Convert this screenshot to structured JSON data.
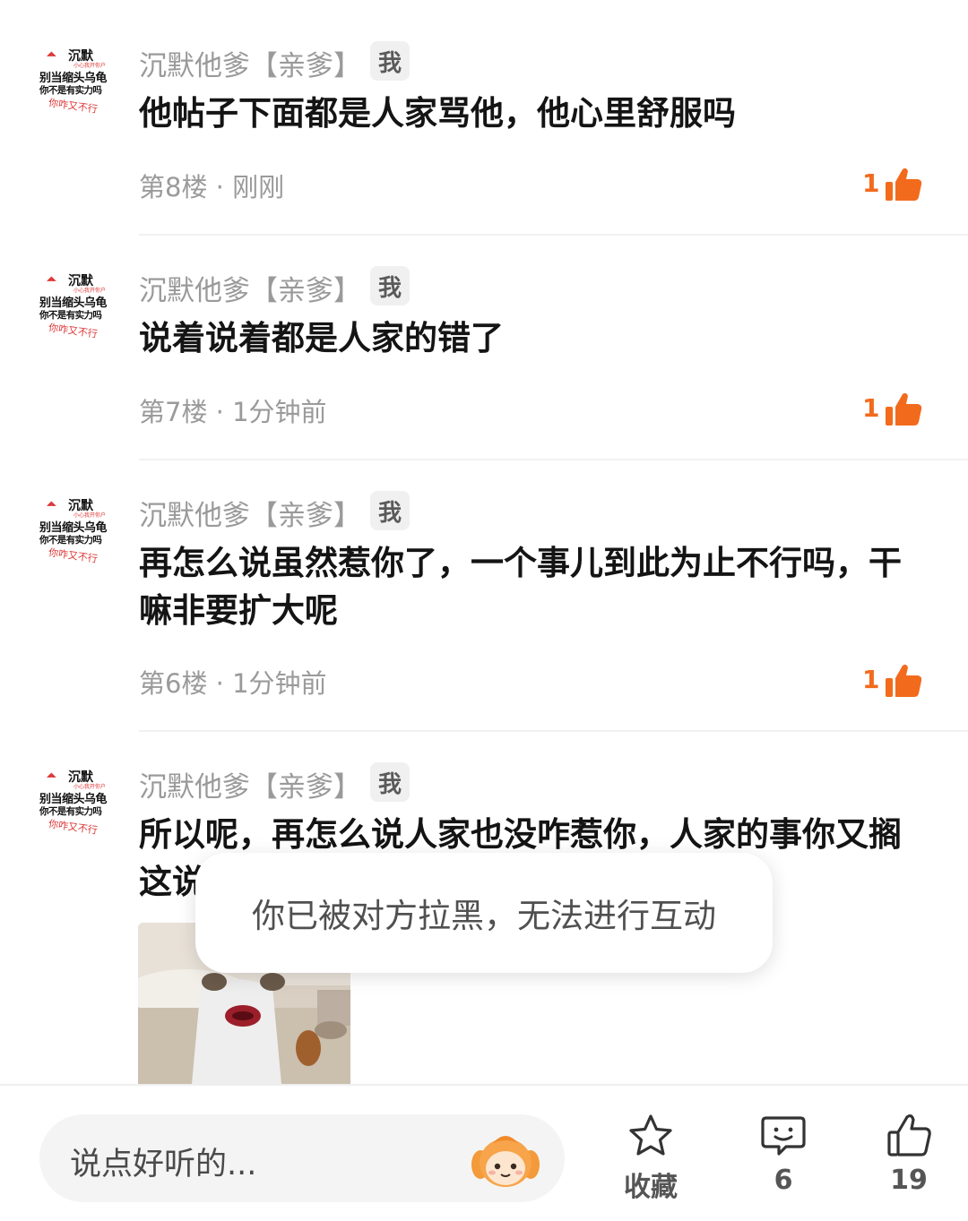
{
  "comments": [
    {
      "avatar": {
        "line1": "沉默",
        "line0": "",
        "line2": "小心我开你户",
        "line3": "别当缩头乌龟",
        "line4": "你不是有实力吗",
        "line5": "你咋又不行"
      },
      "nickname": "沉默他爹【亲爹】",
      "me_badge": "我",
      "text": "他帖子下面都是人家骂他，他心里舒服吗",
      "meta": "第8楼 · 刚刚",
      "likes": "1"
    },
    {
      "avatar": {
        "line1": "沉默",
        "line0": "",
        "line2": "小心我开你户",
        "line3": "别当缩头乌龟",
        "line4": "你不是有实力吗",
        "line5": "你咋又不行"
      },
      "nickname": "沉默他爹【亲爹】",
      "me_badge": "我",
      "text": "说着说着都是人家的错了",
      "meta": "第7楼 · 1分钟前",
      "likes": "1"
    },
    {
      "avatar": {
        "line1": "沉默",
        "line0": "",
        "line2": "小心我开你户",
        "line3": "别当缩头乌龟",
        "line4": "你不是有实力吗",
        "line5": "你咋又不行"
      },
      "nickname": "沉默他爹【亲爹】",
      "me_badge": "我",
      "text": "再怎么说虽然惹你了，一个事儿到此为止不行吗，干嘛非要扩大呢",
      "meta": "第6楼 · 1分钟前",
      "likes": "1"
    },
    {
      "avatar": {
        "line1": "沉默",
        "line0": "",
        "line2": "小心我开你户",
        "line3": "别当缩头乌龟",
        "line4": "你不是有实力吗",
        "line5": "你咋又不行"
      },
      "nickname": "沉默他爹【亲爹】",
      "me_badge": "我",
      "text": "所以呢，再怎么说人家也没咋惹你，人家的事你又搁这说",
      "meta": "",
      "likes": ""
    }
  ],
  "toast": "你已被对方拉黑，无法进行互动",
  "bottom_bar": {
    "input_placeholder": "说点好听的...",
    "favorite_label": "收藏",
    "comment_count": "6",
    "like_count": "19"
  },
  "colors": {
    "accent": "#f26b1d",
    "text": "#141414",
    "muted": "#9a9a9a"
  }
}
